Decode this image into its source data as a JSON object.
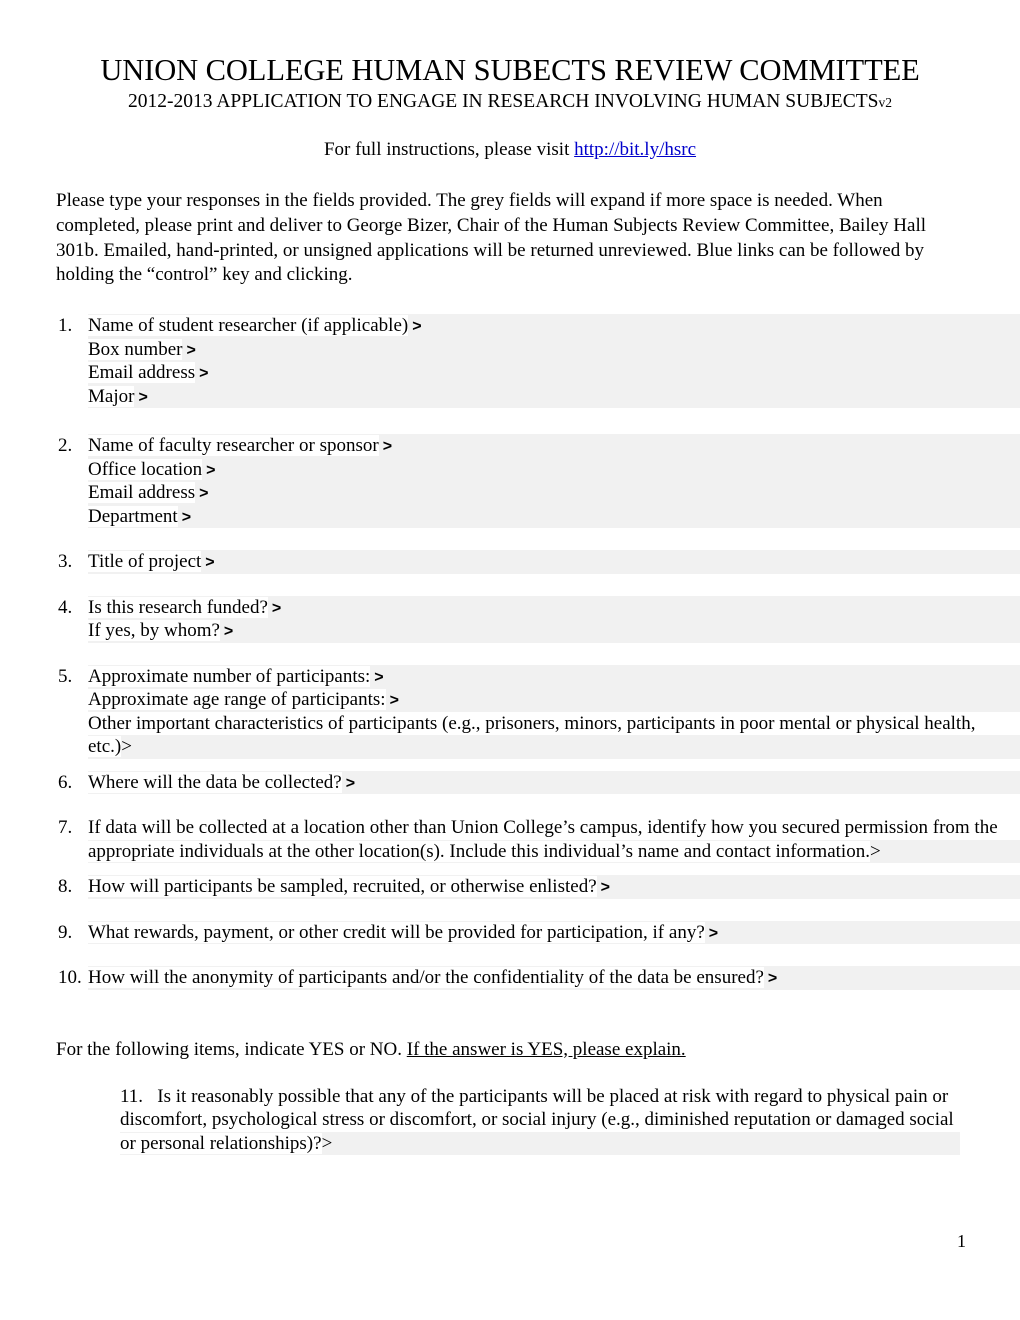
{
  "document": {
    "title": "UNION COLLEGE HUMAN SUBECTS REVIEW COMMITTEE",
    "subtitle_main": "2012-2013 APPLICATION TO ENGAGE IN RESEARCH INVOLVING HUMAN SUBJECTS",
    "subtitle_version": "v2",
    "instructions_prefix": "For full instructions, please visit ",
    "instructions_link": "http://bit.ly/hsrc",
    "intro": "Please type your responses in the fields provided.  The grey fields will expand if more space is needed.  When completed, please print and deliver to George Bizer, Chair of the Human Subjects Review Committee, Bailey Hall 301b.  Emailed, hand-printed, or unsigned applications will be returned unreviewed.  Blue links can be followed by holding the “control” key and clicking.",
    "page_number": "1",
    "field_marker": ">",
    "field_color": "#f1f1f1",
    "link_color": "#0000cc"
  },
  "questions": [
    {
      "number": "1.",
      "rows": [
        {
          "label": "Name of student researcher (if applicable)"
        },
        {
          "label": "Box number"
        },
        {
          "label": "Email address"
        },
        {
          "label": "Major"
        }
      ]
    },
    {
      "number": "2.",
      "rows": [
        {
          "label": "Name of faculty researcher or sponsor"
        },
        {
          "label": "Office location"
        },
        {
          "label": "Email address"
        },
        {
          "label": "Department"
        }
      ]
    },
    {
      "number": "3.",
      "rows": [
        {
          "label": "Title of project"
        }
      ]
    },
    {
      "number": "4.",
      "rows": [
        {
          "label": "Is this research funded?"
        },
        {
          "label": "If yes, by whom?"
        }
      ]
    },
    {
      "number": "5.",
      "rows": [
        {
          "label": "Approximate number of participants:"
        },
        {
          "label": "Approximate age range of participants:"
        },
        {
          "label": "Other important characteristics of participants (e.g., prisoners, minors, participants in poor mental or physical health, etc.)",
          "wrap": true
        }
      ]
    },
    {
      "number": "6.",
      "rows": [
        {
          "label": "Where will the data be collected?"
        }
      ]
    },
    {
      "number": "7.",
      "rows": [
        {
          "label": "If data will be collected at a location other than Union College’s campus, identify how you secured permission from the appropriate individuals at the other location(s).  Include this individual’s name and contact information.",
          "wrap": true
        }
      ]
    },
    {
      "number": "8.",
      "rows": [
        {
          "label": "How will participants be sampled, recruited, or otherwise enlisted?"
        }
      ]
    },
    {
      "number": "9.",
      "rows": [
        {
          "label": "What rewards, payment, or other credit will be provided for participation, if any?"
        }
      ]
    },
    {
      "number": "10.",
      "rows": [
        {
          "label": "How will the anonymity of participants and/or the confidentiality of the data be ensured?"
        }
      ]
    }
  ],
  "yesno_section": {
    "lead_text": "For the following items, indicate YES or NO.  ",
    "underlined_text": "If the answer is YES, please explain.",
    "item": {
      "number": "11.",
      "label": "Is it reasonably possible that any of the participants will be placed at risk with regard to physical pain or discomfort, psychological stress or discomfort, or social injury (e.g., diminished reputation or damaged social or personal relationships)?"
    }
  }
}
